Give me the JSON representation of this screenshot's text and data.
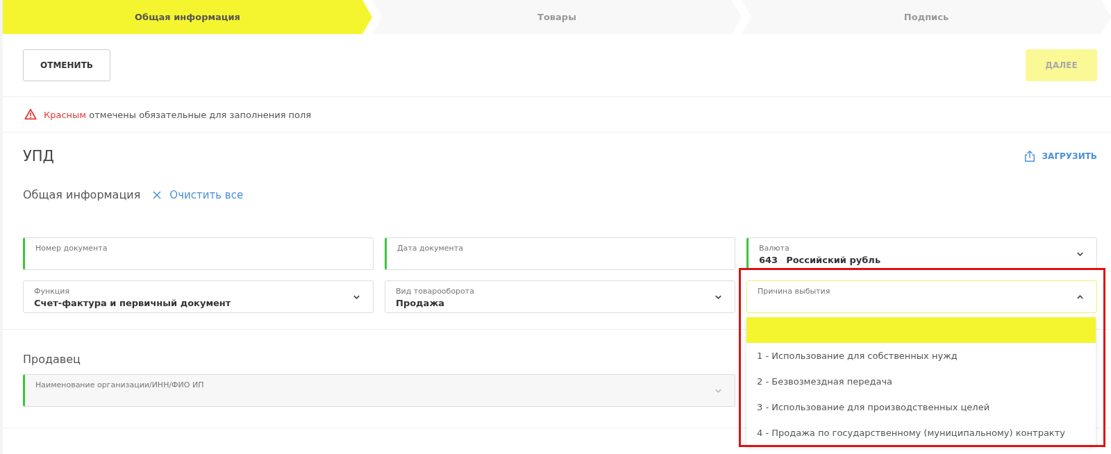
{
  "steps": [
    {
      "label": "Общая информация",
      "selected": true
    },
    {
      "label": "Товары",
      "selected": false
    },
    {
      "label": "Подпись",
      "selected": false
    }
  ],
  "actions": {
    "cancel": {
      "label": "ОТМЕНИТЬ",
      "disabled": false
    },
    "next": {
      "label": "ДАЛЕЕ",
      "disabled": true
    }
  },
  "notice": {
    "highlight": "Красным",
    "text": "отмечены обязательные для заполнения поля"
  },
  "document": {
    "title": "УПД",
    "upload": "ЗАГРУЗИТЬ"
  },
  "general": {
    "title": "Общая информация",
    "clear": "Очистить все",
    "fields": [
      {
        "kind": "text",
        "label": "Номер документа",
        "required": true
      },
      {
        "kind": "text",
        "label": "Дата документа",
        "required": true
      },
      {
        "kind": "select",
        "label": "Валюта",
        "code": "643",
        "value": "Российский рубль",
        "required": true,
        "expanded": false
      },
      {
        "kind": "select",
        "label": "Функция",
        "value": "Счет-фактура и первичный документ",
        "required": false,
        "expanded": false
      },
      {
        "kind": "select",
        "label": "Вид товарооборота",
        "value": "Продажа",
        "required": false,
        "expanded": false
      },
      {
        "kind": "select",
        "label": "Причина выбытия",
        "required": false,
        "expanded": true,
        "options": [
          {
            "selected": true
          },
          {
            "label": "1 - Использование для собственных нужд",
            "selected": false
          },
          {
            "label": "2 - Безвозмездная передача",
            "selected": false
          },
          {
            "label": "3 - Использование для производственных целей",
            "selected": false
          },
          {
            "label": "4 - Продажа по государственному (муниципальному) контракту",
            "selected": false
          }
        ]
      }
    ]
  },
  "seller": {
    "title": "Продавец",
    "field": {
      "kind": "select",
      "label": "Наименование организации/ИНН/ФИО ИП",
      "required": true,
      "disabled": true
    }
  }
}
